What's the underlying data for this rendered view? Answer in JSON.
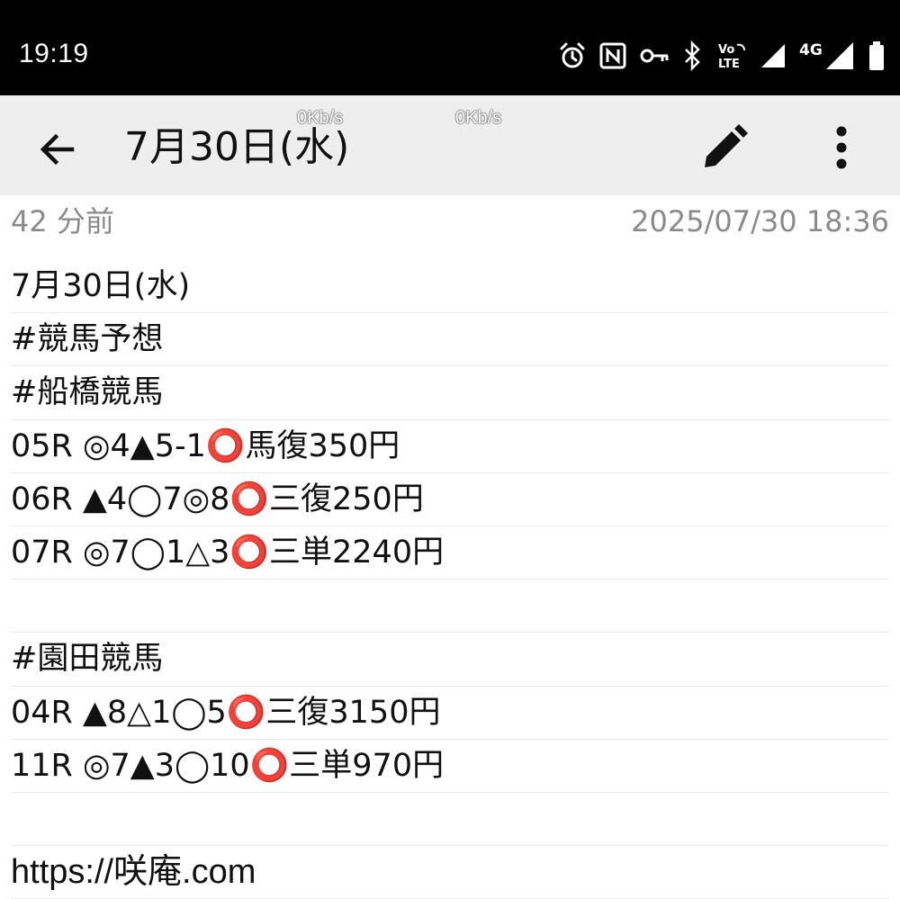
{
  "status_bar": {
    "time": "19:19",
    "icons": [
      "alarm-icon",
      "nfc-icon",
      "vpn-key-icon",
      "bluetooth-icon",
      "volte-icon",
      "signal-icon",
      "4g-signal-icon",
      "battery-icon"
    ],
    "volte_label_top": "Vo",
    "volte_label_bottom": "LTE",
    "network_type": "4G"
  },
  "net_speed": {
    "left": "0Kb/s",
    "right": "0Kb/s"
  },
  "app_bar": {
    "title": "7月30日(水)",
    "back_icon": "arrow-back-icon",
    "edit_icon": "pencil-icon",
    "more_icon": "more-vert-icon"
  },
  "meta": {
    "relative_time": "42 分前",
    "timestamp": "2025/07/30 18:36"
  },
  "note": {
    "lines": [
      {
        "pre": "7月30日(水)",
        "ring": "",
        "post": ""
      },
      {
        "pre": "#競馬予想",
        "ring": "",
        "post": ""
      },
      {
        "pre": "#船橋競馬",
        "ring": "",
        "post": ""
      },
      {
        "pre": "05R ◎4▲5-1",
        "ring": "⭕",
        "post": "馬復350円"
      },
      {
        "pre": "06R ▲4◯7◎8",
        "ring": "⭕",
        "post": "三復250円"
      },
      {
        "pre": "07R ◎7◯1△3",
        "ring": "⭕",
        "post": "三単2240円"
      },
      {
        "pre": "",
        "ring": "",
        "post": ""
      },
      {
        "pre": "#園田競馬",
        "ring": "",
        "post": ""
      },
      {
        "pre": "04R ▲8△1◯5",
        "ring": "⭕",
        "post": "三復3150円"
      },
      {
        "pre": "11R ◎7▲3◯10",
        "ring": "⭕",
        "post": "三単970円"
      },
      {
        "pre": "",
        "ring": "",
        "post": ""
      },
      {
        "pre": "https://咲庵.com",
        "ring": "",
        "post": ""
      }
    ]
  },
  "colors": {
    "status_bar_bg": "#000000",
    "app_bar_bg": "#eeeeee",
    "meta_text": "#8a8a8a",
    "ring": "#e0352b",
    "rule_line": "#e9e9e9"
  }
}
